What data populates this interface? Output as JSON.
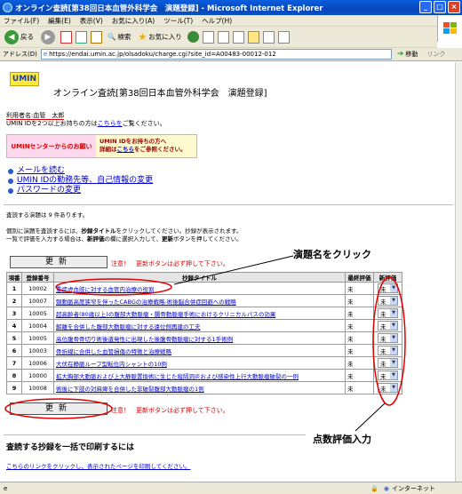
{
  "window": {
    "title": "オンライン査読[第38回日本血管外科学会　演題登録] - Microsoft Internet Explorer",
    "min": "_",
    "max": "□",
    "close": "×"
  },
  "menu": [
    "ファイル(F)",
    "編集(E)",
    "表示(V)",
    "お気に入り(A)",
    "ツール(T)",
    "ヘルプ(H)"
  ],
  "toolbar": {
    "back": "戻る",
    "search": "検索",
    "favorites": "お気に入り"
  },
  "address": {
    "label": "アドレス(D)",
    "url": "https://endai.umin.ac.jp/olsadoku/charge.cgi?site_id=A00483-00012-012",
    "go": "移動",
    "links": "リンク"
  },
  "page": {
    "logo": "UMIN",
    "title": "オンライン査読[第38回日本血管外科学会　演題登録]",
    "user_label": "利用者名:",
    "user_name": "血管　太郎",
    "two_ids_prefix": "UMIN IDを2つ以上お持ちの方は",
    "two_ids_link": "こちらを",
    "two_ids_suffix": "ご覧ください。",
    "umin_box_left": "UMINセンターからのお願い",
    "umin_box_right_1": "UMIN IDをお持ちの方へ",
    "umin_box_right_2a": "詳細は",
    "umin_box_right_link": "こちら",
    "umin_box_right_2b": "をご参照ください。",
    "links": [
      "メールを読む",
      "UMIN IDの勤務先等、自己情報の変更",
      "パスワードの変更"
    ],
    "count_text": "査読する演題は 9 件あります。",
    "instr_1": "個別に演題を査読するには、",
    "instr_1b": "抄録タイトル",
    "instr_1c": "をクリックしてください。抄録が表示されます。",
    "instr_2": "一覧で評価を入力する場合は、",
    "instr_2b": "新評価",
    "instr_2c": "の欄に選択入力して、",
    "instr_2d": "更新",
    "instr_2e": "ボタンを押してください。",
    "update_label": "更新",
    "warn": "注意！　更新ボタンは必ず押して下さい。",
    "annot_title": "演題名をクリック",
    "annot_score": "点数評価入力",
    "bottom_title": "査読する抄録を一括で印刷するには",
    "bottom_link": "こちらのリンクをクリックし、表示されたページを印刷してください。"
  },
  "table": {
    "headers": [
      "項番",
      "登録番号",
      "抄録タイトル",
      "最終評価",
      "新評価"
    ],
    "rows": [
      {
        "no": "1",
        "reg": "10002",
        "title": "重症虚血肢に対する血管内治療の役割",
        "final": "未",
        "new": "未"
      },
      {
        "no": "2",
        "reg": "10007",
        "title": "頸動脈高度狭窄を伴ったCABGの治療戦略-術後脳合併症回避への戦略",
        "final": "未",
        "new": "未"
      },
      {
        "no": "3",
        "reg": "10005",
        "title": "超高齢者(80歳以上)の腹部大動脈瘤・腸骨動脈瘤手術におけるクリニカルパスの効果",
        "final": "未",
        "new": "未"
      },
      {
        "no": "4",
        "reg": "10004",
        "title": "解離を合併した腹部大動脈瘤に対する遠位側再建の工夫",
        "final": "未",
        "new": "未"
      },
      {
        "no": "5",
        "reg": "10005",
        "title": "高位腹骨骨切り術後遺発性に出現した後腹骨動脈瘤に対する1手術例",
        "final": "未",
        "new": "未"
      },
      {
        "no": "6",
        "reg": "10003",
        "title": "骨折線に合併した血管損傷の特徴と治療戦略",
        "final": "未",
        "new": "未"
      },
      {
        "no": "7",
        "reg": "10006",
        "title": "大伏在静脈ループ型転位内シャントの10例",
        "final": "未",
        "new": "未"
      },
      {
        "no": "8",
        "reg": "10000",
        "title": "拡大胸部大動脈および上大静脈置換術に生じた縦隔洞炎および感染性上行大動脈瘤破裂の一例",
        "final": "未",
        "new": "未"
      },
      {
        "no": "9",
        "reg": "10008",
        "title": "術後に下肢の対麻痺を合併した非破裂腹部大動脈瘤の1例",
        "final": "未",
        "new": "未"
      }
    ]
  },
  "status": {
    "zone": "インターネット",
    "lock": "🔒"
  },
  "colors": {
    "annotation_red": "#e00000",
    "title_blue": "#0747b8",
    "link": "#0000cc"
  }
}
